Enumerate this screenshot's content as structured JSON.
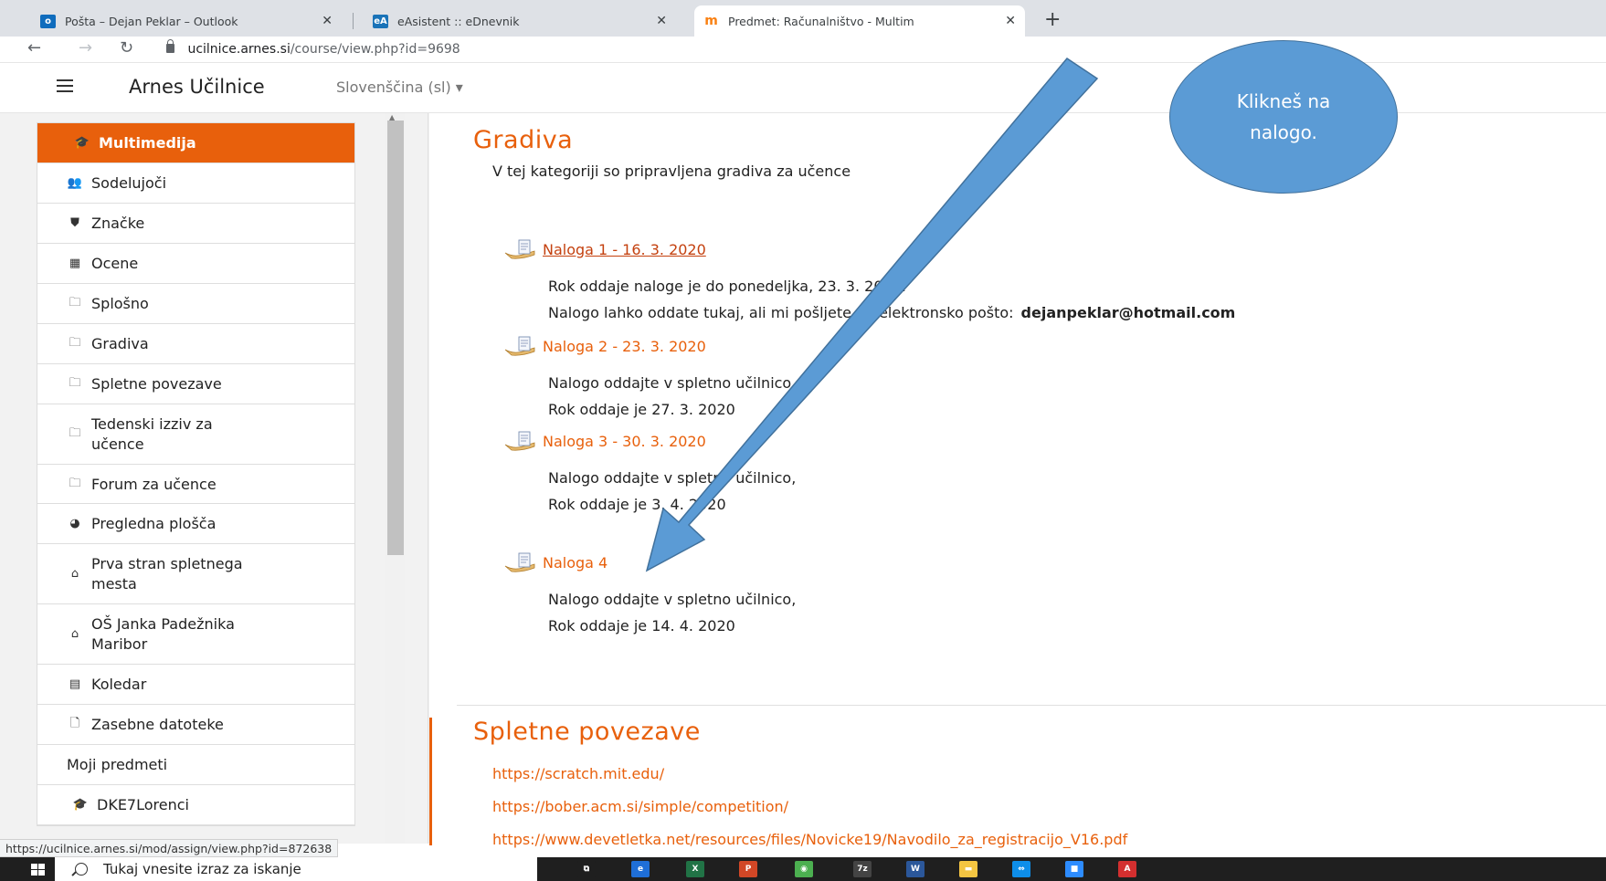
{
  "browser": {
    "tabs": [
      {
        "title": "Pošta – Dejan Peklar – Outlook",
        "favicon": "outlook-icon",
        "color": "#0f6cbd",
        "glyph": "o"
      },
      {
        "title": "eAsistent :: eDnevnik",
        "favicon": "easistent-icon",
        "color": "#1a73b8",
        "glyph": "eA"
      },
      {
        "title": "Predmet: Računalništvo - Multim",
        "favicon": "moodle-icon",
        "color": "#f98012",
        "glyph": "m"
      }
    ],
    "url_host": "ucilnice.arnes.si",
    "url_path": "/course/view.php?id=9698"
  },
  "navbar": {
    "brand": "Arnes Učilnice",
    "language": "Slovenščina (sl) ▾"
  },
  "sidebar": {
    "course_items": [
      {
        "label": "Multimedija",
        "icon": "graduation-cap-icon",
        "glyph": "🎓",
        "header": true
      },
      {
        "label": "Sodelujoči",
        "icon": "users-icon",
        "glyph": "👥"
      },
      {
        "label": "Značke",
        "icon": "shield-icon",
        "glyph": "⛊"
      },
      {
        "label": "Ocene",
        "icon": "table-icon",
        "glyph": "▦"
      },
      {
        "label": "Splošno",
        "icon": "folder-icon",
        "glyph": "🗀"
      },
      {
        "label": "Gradiva",
        "icon": "folder-icon",
        "glyph": "🗀"
      },
      {
        "label": "Spletne povezave",
        "icon": "folder-icon",
        "glyph": "🗀"
      },
      {
        "label": "Tedenski izziv za učence",
        "icon": "folder-icon",
        "glyph": "🗀",
        "tall": true
      },
      {
        "label": "Forum za učence",
        "icon": "folder-icon",
        "glyph": "🗀"
      }
    ],
    "site_items": [
      {
        "label": "Pregledna plošča",
        "icon": "dashboard-icon",
        "glyph": "◕"
      },
      {
        "label": "Prva stran spletnega mesta",
        "icon": "home-icon",
        "glyph": "⌂",
        "tall": true
      },
      {
        "label": "OŠ Janka Padežnika Maribor",
        "icon": "home-icon",
        "glyph": "⌂",
        "tall": true
      },
      {
        "label": "Koledar",
        "icon": "calendar-icon",
        "glyph": "▤"
      },
      {
        "label": "Zasebne datoteke",
        "icon": "file-icon",
        "glyph": "🗋"
      },
      {
        "label": "Moji predmeti",
        "icon": "",
        "glyph": ""
      },
      {
        "label": "DKE7Lorenci",
        "icon": "graduation-cap-icon",
        "glyph": "🎓",
        "indent": true
      }
    ]
  },
  "main": {
    "gradiva": {
      "title": "Gradiva",
      "summary": "V tej kategoriji so pripravljena gradiva za učence"
    },
    "assignments": [
      {
        "name": "Naloga 1 - 16. 3. 2020",
        "visited": true,
        "lines": [
          "Rok oddaje naloge je do ponedeljka, 23. 3. 2020.",
          "Nalogo lahko oddate tukaj, ali mi pošljete na elektronsko pošto:"
        ],
        "email": "dejanpeklar@hotmail.com"
      },
      {
        "name": "Naloga 2 - 23. 3. 2020",
        "visited": false,
        "lines": [
          "Nalogo oddajte v spletno učilnico,",
          "Rok oddaje je 27. 3. 2020"
        ]
      },
      {
        "name": "Naloga 3 - 30. 3. 2020",
        "visited": false,
        "lines": [
          "Nalogo oddajte v spletno učilnico,",
          "Rok oddaje je 3. 4. 2020"
        ]
      },
      {
        "name": "Naloga 4",
        "visited": false,
        "lines": [
          "Nalogo oddajte v spletno učilnico,",
          "Rok oddaje je 14. 4. 2020"
        ]
      }
    ],
    "spletne": {
      "title": "Spletne povezave",
      "links": [
        "https://scratch.mit.edu/",
        "https://bober.acm.si/simple/competition/",
        "https://www.devetletka.net/resources/files/Novicke19/Navodilo_za_registracijo_V16.pdf"
      ]
    }
  },
  "annotation": {
    "callout_text": "Klikneš na nalogo.",
    "fill_color": "#5b9bd5"
  },
  "status_url": "https://ucilnice.arnes.si/mod/assign/view.php?id=872638",
  "taskbar": {
    "search_placeholder": "Tukaj vnesite izraz za iskanje",
    "apps": [
      {
        "name": "task-view-icon",
        "color": "#1f1f1f",
        "glyph": "⧉"
      },
      {
        "name": "edge-icon",
        "color": "#1f6fd8",
        "glyph": "e"
      },
      {
        "name": "excel-icon",
        "color": "#217346",
        "glyph": "X"
      },
      {
        "name": "powerpoint-icon",
        "color": "#d24726",
        "glyph": "P"
      },
      {
        "name": "chrome-icon",
        "color": "#4caf50",
        "glyph": "◉"
      },
      {
        "name": "7zip-icon",
        "color": "#444444",
        "glyph": "7z"
      },
      {
        "name": "word-icon",
        "color": "#2b579a",
        "glyph": "W"
      },
      {
        "name": "file-explorer-icon",
        "color": "#f4c542",
        "glyph": "▬"
      },
      {
        "name": "teamviewer-icon",
        "color": "#0e8ee9",
        "glyph": "⇔"
      },
      {
        "name": "zoom-icon",
        "color": "#2d8cff",
        "glyph": "■"
      },
      {
        "name": "acrobat-icon",
        "color": "#d32f2f",
        "glyph": "A"
      }
    ]
  }
}
